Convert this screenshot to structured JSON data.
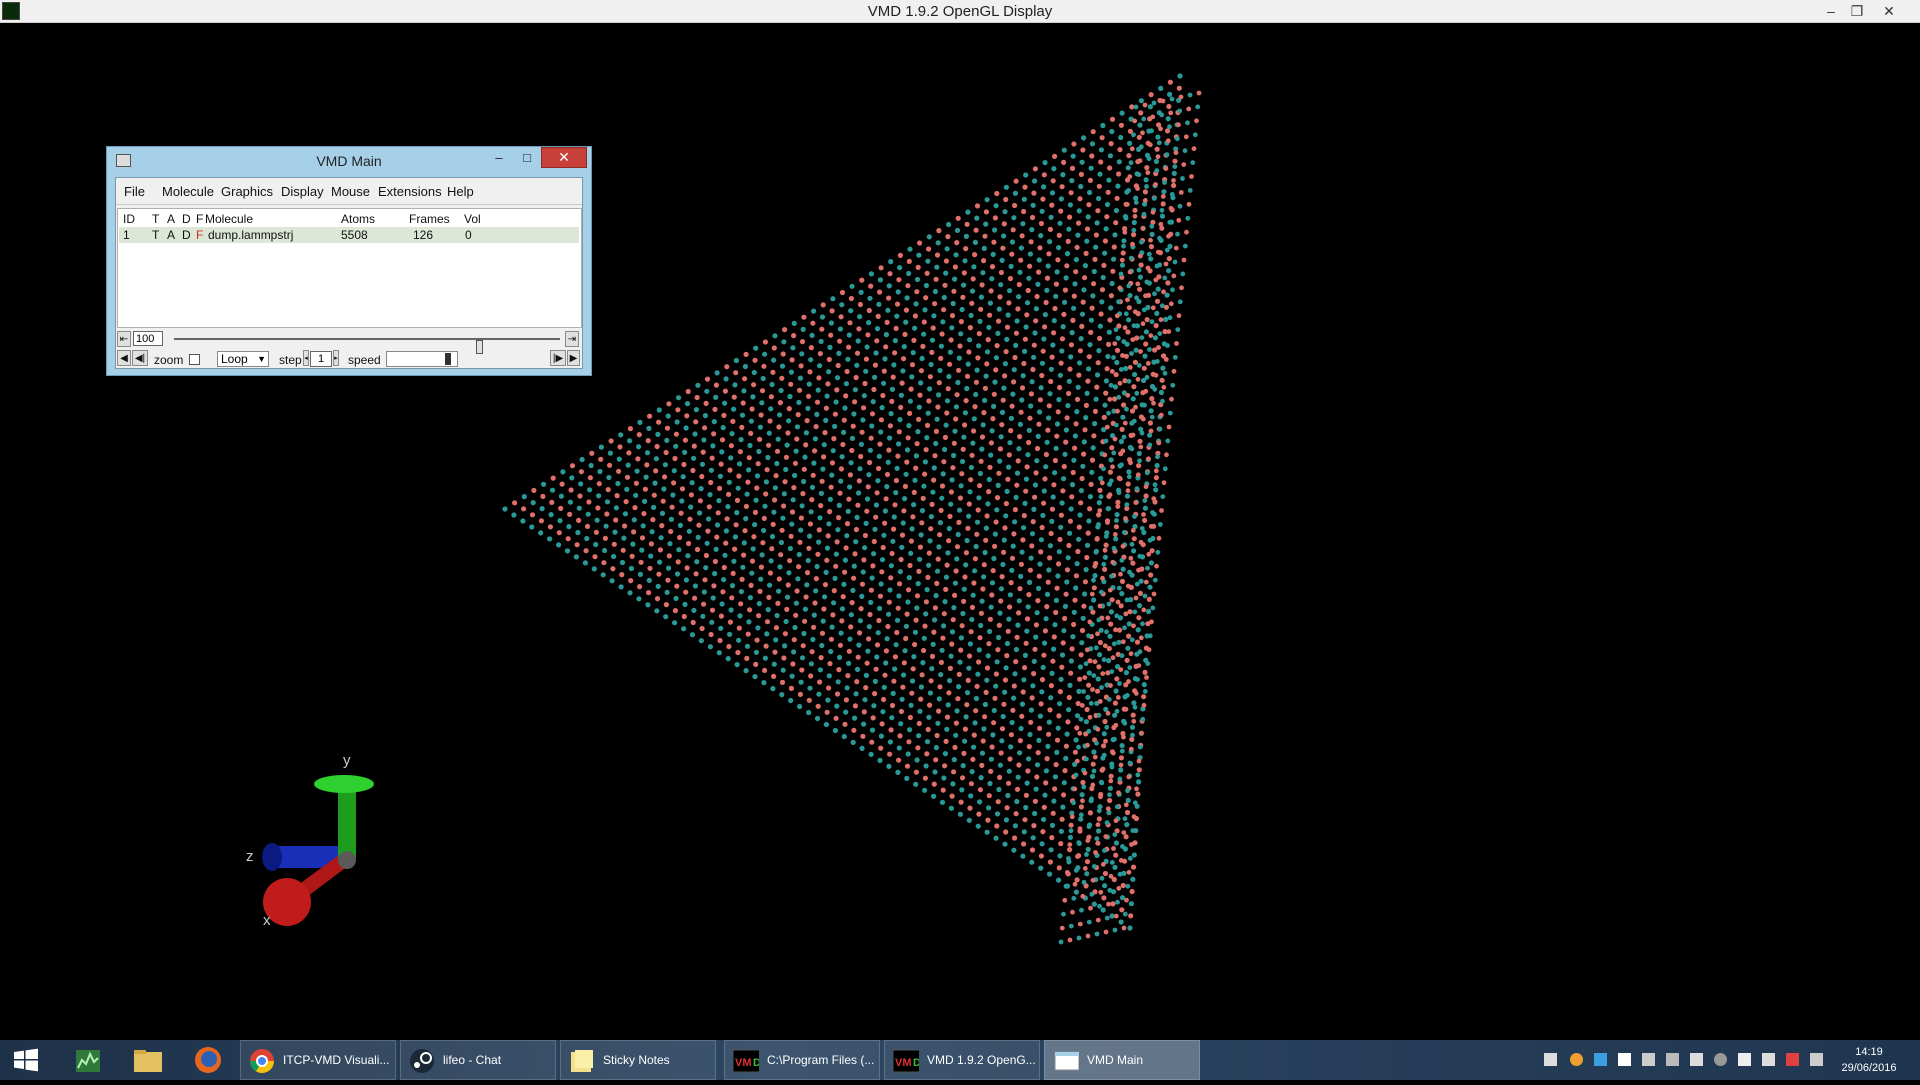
{
  "gl_window": {
    "title": "VMD 1.9.2 OpenGL Display",
    "minimize": "–",
    "restore": "❐",
    "close": "✕"
  },
  "vmd_main": {
    "title": "VMD Main",
    "minimize": "–",
    "maximize": "□",
    "close": "✕",
    "menu": [
      "File",
      "Molecule",
      "Graphics",
      "Display",
      "Mouse",
      "Extensions",
      "Help"
    ],
    "columns": {
      "id": "ID",
      "t": "T",
      "a": "A",
      "d": "D",
      "f": "F",
      "molecule": "Molecule",
      "atoms": "Atoms",
      "frames": "Frames",
      "vol": "Vol"
    },
    "rows": [
      {
        "id": "1",
        "t": "T",
        "a": "A",
        "d": "D",
        "f": "F",
        "molecule": "dump.lammpstrj",
        "atoms": "5508",
        "frames": "126",
        "vol": "0"
      }
    ],
    "animation": {
      "frame": "100",
      "frame_fraction": 0.79,
      "zoom_label": "zoom",
      "zoom_checked": false,
      "mode": "Loop",
      "step_label": "step",
      "step": "1",
      "speed_label": "speed"
    }
  },
  "axes": {
    "x": "x",
    "y": "y",
    "z": "z"
  },
  "taskbar": {
    "items": [
      {
        "label": "ITCP-VMD Visuali...",
        "icon": "chrome-icon"
      },
      {
        "label": "lifeo - Chat",
        "icon": "steam-icon"
      },
      {
        "label": "Sticky Notes",
        "icon": "sticky-notes-icon"
      },
      {
        "label": "C:\\Program Files (...",
        "icon": "vmd-icon"
      },
      {
        "label": "VMD 1.9.2 OpenG...",
        "icon": "vmd-icon"
      },
      {
        "label": "VMD Main",
        "icon": "window-icon"
      }
    ],
    "clock_time": "14:19",
    "clock_date": "29/06/2016"
  },
  "colors": {
    "atom_teal": "#2a9a98",
    "atom_salmon": "#e0706a",
    "titlebar_blue": "#a6cfe8",
    "close_red": "#c7403a",
    "taskbar": "#2c4662"
  }
}
